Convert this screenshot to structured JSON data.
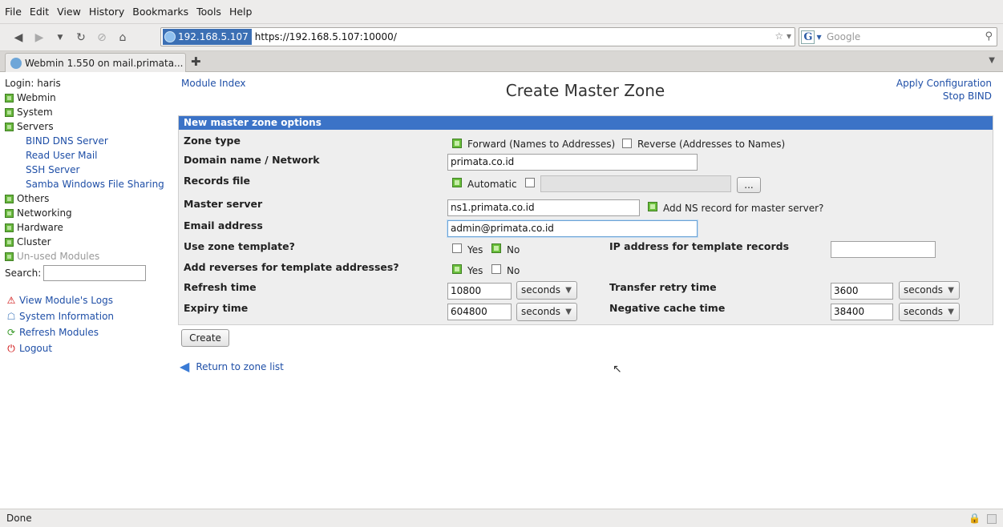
{
  "menu": [
    "File",
    "Edit",
    "View",
    "History",
    "Bookmarks",
    "Tools",
    "Help"
  ],
  "address": {
    "badge": "192.168.5.107",
    "url": "https://192.168.5.107:10000/",
    "star": "☆ ▾"
  },
  "search": {
    "engine": "G",
    "placeholder": "Google"
  },
  "tab": {
    "title": "Webmin 1.550 on mail.primata..."
  },
  "sidebar": {
    "login": "Login: haris",
    "categories": [
      {
        "label": "Webmin"
      },
      {
        "label": "System"
      },
      {
        "label": "Servers"
      }
    ],
    "servers": [
      "BIND DNS Server",
      "Read User Mail",
      "SSH Server",
      "Samba Windows File Sharing"
    ],
    "more": [
      "Others",
      "Networking",
      "Hardware",
      "Cluster"
    ],
    "unused": "Un-used Modules",
    "search_label": "Search:",
    "tools": [
      "View Module's Logs",
      "System Information",
      "Refresh Modules",
      "Logout"
    ]
  },
  "main": {
    "module_index": "Module Index",
    "title": "Create Master Zone",
    "apply": "Apply Configuration",
    "stop": "Stop BIND"
  },
  "form": {
    "header": "New master zone options",
    "zone_type": {
      "label": "Zone type",
      "forward": "Forward (Names to Addresses)",
      "reverse": "Reverse (Addresses to Names)"
    },
    "domain": {
      "label": "Domain name / Network",
      "value": "primata.co.id"
    },
    "records": {
      "label": "Records file",
      "automatic": "Automatic",
      "browse": "..."
    },
    "master": {
      "label": "Master server",
      "value": "ns1.primata.co.id",
      "ns_label": "Add NS record for master server?"
    },
    "email": {
      "label": "Email address",
      "value": "admin@primata.co.id"
    },
    "template": {
      "label": "Use zone template?",
      "yes": "Yes",
      "no": "No",
      "ip_label": "IP address for template records"
    },
    "reverses": {
      "label": "Add reverses for template addresses?",
      "yes": "Yes",
      "no": "No"
    },
    "refresh": {
      "label": "Refresh time",
      "value": "10800",
      "unit": "seconds"
    },
    "retry": {
      "label": "Transfer retry time",
      "value": "3600",
      "unit": "seconds"
    },
    "expiry": {
      "label": "Expiry time",
      "value": "604800",
      "unit": "seconds"
    },
    "negative": {
      "label": "Negative cache time",
      "value": "38400",
      "unit": "seconds"
    }
  },
  "actions": {
    "create": "Create",
    "return": "Return to zone list"
  },
  "status": {
    "text": "Done"
  },
  "colors": {
    "header_blue": "#3b73c7",
    "link": "#1f4fa7",
    "check_green": "#6abf3c"
  }
}
